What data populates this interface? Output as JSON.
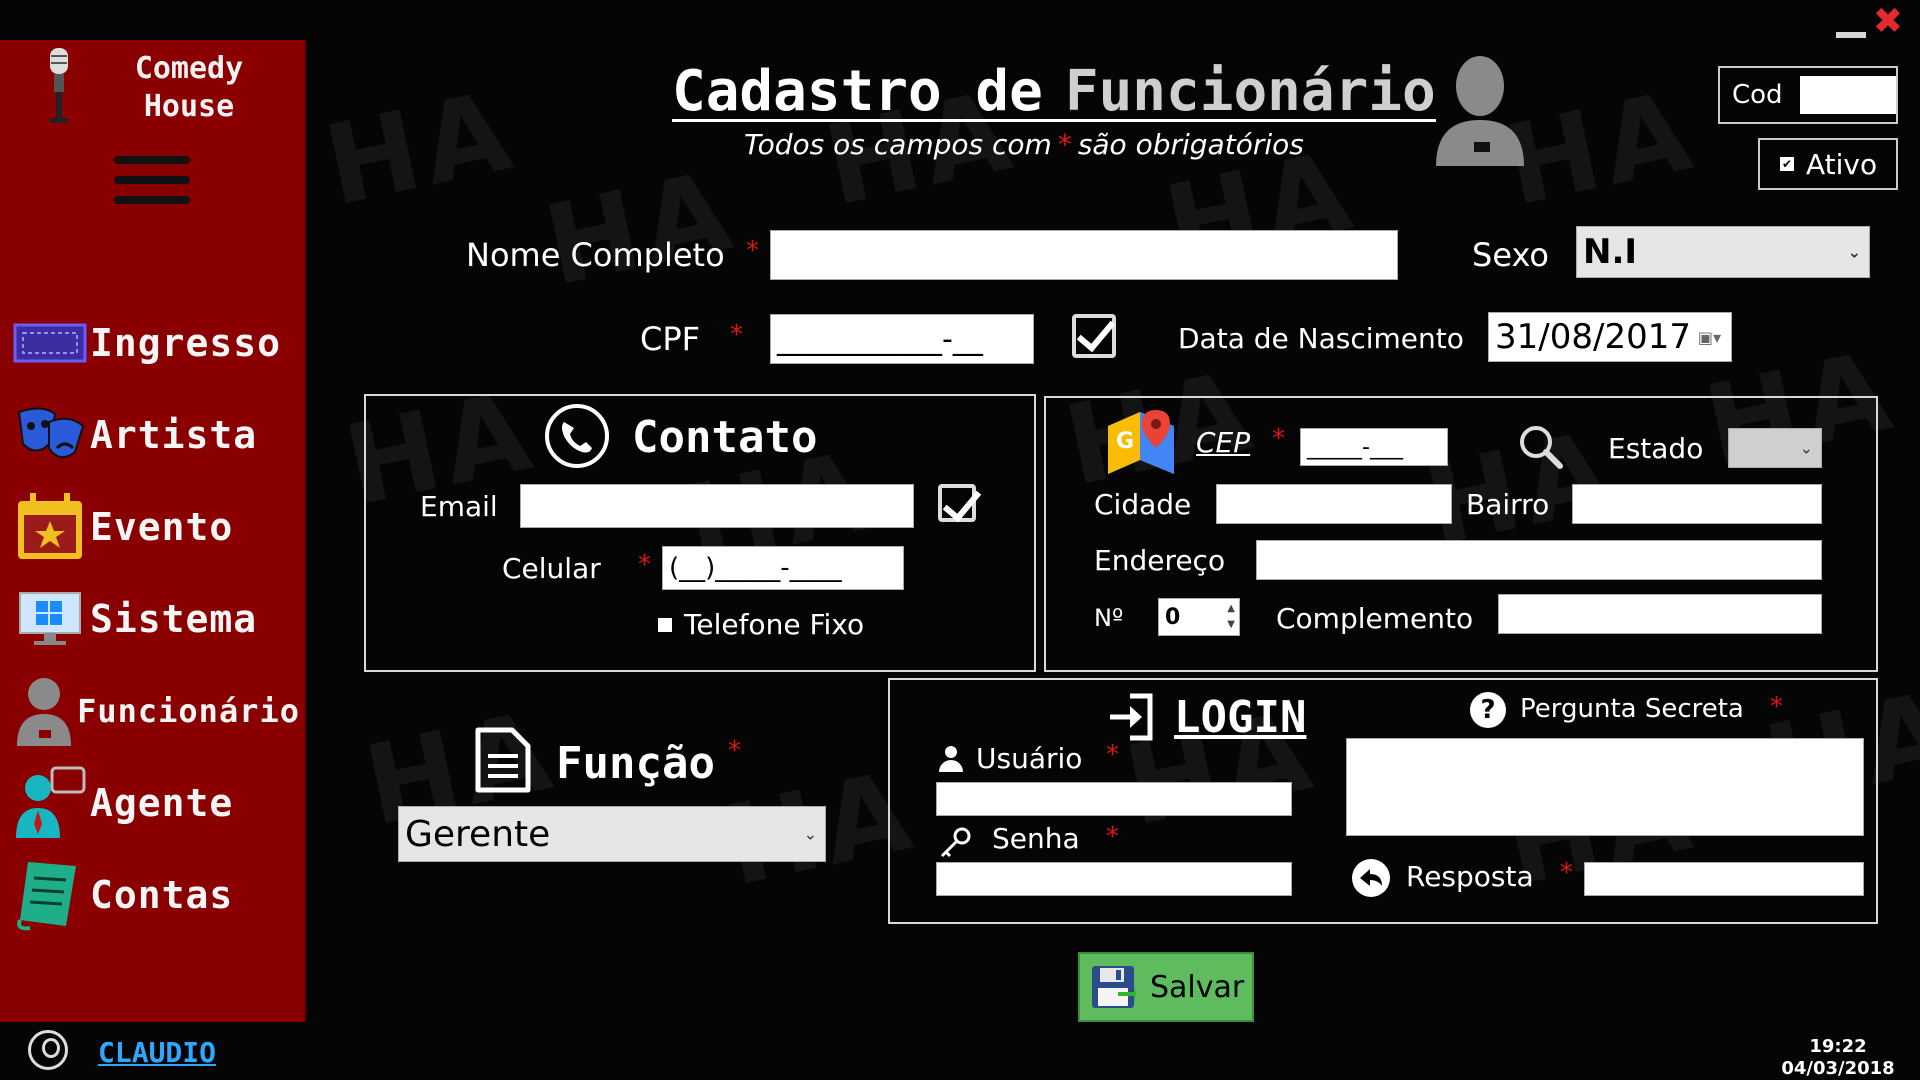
{
  "window": {
    "minimize_icon": "minimize-icon",
    "close_icon": "close-icon",
    "close_glyph": "✖"
  },
  "watermark_text": "HA",
  "sidebar": {
    "brand": {
      "line1": "Comedy",
      "line2": "House"
    },
    "menu_icon": "hamburger-icon",
    "items": [
      {
        "label": "Ingresso",
        "icon": "ticket-icon"
      },
      {
        "label": "Artista",
        "icon": "theater-masks-icon"
      },
      {
        "label": "Evento",
        "icon": "calendar-star-icon"
      },
      {
        "label": "Sistema",
        "icon": "windows-monitor-icon"
      },
      {
        "label": "Funcionário",
        "icon": "employee-icon"
      },
      {
        "label": "Agente",
        "icon": "agent-icon"
      },
      {
        "label": "Contas",
        "icon": "bill-icon"
      }
    ]
  },
  "status_bar": {
    "user": "CLAUDIO",
    "time": "19:22",
    "date": "04/03/2018"
  },
  "header": {
    "title_part1": "Cadastro de",
    "title_part2": "Funcionário",
    "subtitle_pre": "Todos os campos com",
    "subtitle_star": "*",
    "subtitle_post": "são obrigatórios",
    "cod_label": "Cod",
    "cod_value": "",
    "ativo_label": "Ativo",
    "ativo_checked": true
  },
  "form": {
    "nome_label": "Nome Completo",
    "nome_value": "",
    "sexo_label": "Sexo",
    "sexo_value": "N.I",
    "cpf_label": "CPF",
    "cpf_value": "___________-__",
    "nascimento_label": "Data de Nascimento",
    "nascimento_value": "31/08/2017",
    "required_mark": "*"
  },
  "contato": {
    "title": "Contato",
    "email_label": "Email",
    "email_value": "",
    "celular_label": "Celular",
    "celular_value": "(__)_____-____",
    "telefone_fixo_label": "Telefone Fixo",
    "telefone_fixo_checked": false
  },
  "endereco": {
    "cep_label": "CEP",
    "cep_value": "_____-___",
    "estado_label": "Estado",
    "estado_value": "",
    "cidade_label": "Cidade",
    "cidade_value": "",
    "bairro_label": "Bairro",
    "bairro_value": "",
    "endereco_label": "Endereço",
    "endereco_value": "",
    "numero_label": "Nº",
    "numero_value": "0",
    "complemento_label": "Complemento",
    "complemento_value": ""
  },
  "funcao": {
    "title": "Função",
    "value": "Gerente"
  },
  "login": {
    "title": "LOGIN",
    "usuario_label": "Usuário",
    "usuario_value": "",
    "senha_label": "Senha",
    "senha_value": "",
    "pergunta_label": "Pergunta Secreta",
    "pergunta_value": "",
    "resposta_label": "Resposta",
    "resposta_value": ""
  },
  "actions": {
    "save_label": "Salvar"
  },
  "colors": {
    "sidebar": "#8a0000",
    "accent_red": "#e01515",
    "save_green": "#5ebc5e",
    "user_link": "#2ea8ff"
  }
}
